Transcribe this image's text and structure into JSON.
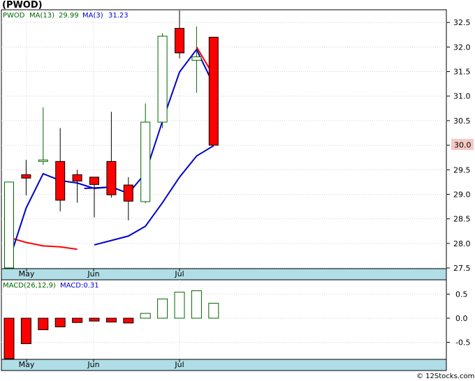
{
  "title": "(PWOD)",
  "footer": "© 12Stocks.com",
  "colors": {
    "up_fill": "#ffffff",
    "up_stroke": "#006400",
    "down_fill": "#ff0000",
    "down_stroke": "#000000",
    "ma13": "#ff0000",
    "ma3": "#0000cc",
    "axis_bar": "#b0dde6",
    "grid": "#d3d3d3",
    "last_label_bg": "#f5c9c4"
  },
  "price_legend": {
    "symbol": "PWOD",
    "ma13_label": "MA(13)",
    "ma13_value": "29.99",
    "ma3_label": "MA(3)",
    "ma3_value": "31.23"
  },
  "macd_legend": {
    "label": "MACD(26,12,9)",
    "value_label": "MACD:0.31"
  },
  "last_price_label": "30.0",
  "x_axis_labels": [
    "May",
    "Jun",
    "Jul"
  ],
  "chart_data": [
    {
      "type": "candlestick",
      "ylim": [
        27.4,
        32.75
      ],
      "yticks": [
        "27.5",
        "28.0",
        "28.5",
        "29.0",
        "29.5",
        "30.0",
        "30.5",
        "31.0",
        "31.5",
        "32.0",
        "32.5"
      ],
      "candles": [
        {
          "o": 27.5,
          "h": 29.25,
          "l": 27.5,
          "c": 29.25
        },
        {
          "o": 29.4,
          "h": 29.7,
          "l": 28.98,
          "c": 29.33
        },
        {
          "o": 29.67,
          "h": 30.77,
          "l": 29.6,
          "c": 29.7
        },
        {
          "o": 29.67,
          "h": 30.35,
          "l": 28.65,
          "c": 28.88
        },
        {
          "o": 29.4,
          "h": 29.5,
          "l": 28.83,
          "c": 29.27
        },
        {
          "o": 29.35,
          "h": 29.35,
          "l": 28.53,
          "c": 29.2
        },
        {
          "o": 29.67,
          "h": 30.68,
          "l": 28.93,
          "c": 28.99
        },
        {
          "o": 29.19,
          "h": 29.35,
          "l": 28.47,
          "c": 28.86
        },
        {
          "o": 28.85,
          "h": 30.85,
          "l": 28.82,
          "c": 30.47
        },
        {
          "o": 30.47,
          "h": 32.28,
          "l": 30.35,
          "c": 32.22
        },
        {
          "o": 32.38,
          "h": 32.75,
          "l": 31.77,
          "c": 31.88
        },
        {
          "o": 31.73,
          "h": 32.42,
          "l": 31.07,
          "c": 31.8
        },
        {
          "o": 32.2,
          "h": 32.2,
          "l": 30.0,
          "c": 30.0
        }
      ],
      "series": [
        {
          "name": "MA(13)",
          "values": [
            28.12,
            28.02,
            27.95,
            27.93,
            27.88,
            null,
            null,
            null,
            null,
            null,
            null,
            32.0,
            31.42
          ]
        },
        {
          "name": "MA(3)",
          "values": [
            27.65,
            28.72,
            29.42,
            29.28,
            29.23,
            29.12,
            29.15,
            29.02,
            29.43,
            30.49,
            31.49,
            31.95,
            31.23
          ]
        },
        {
          "name": "lower",
          "values": [
            null,
            null,
            null,
            null,
            null,
            27.97,
            28.06,
            28.15,
            28.35,
            28.83,
            29.35,
            29.78,
            29.99
          ]
        }
      ]
    },
    {
      "type": "bar",
      "ylim": [
        -0.9,
        0.75
      ],
      "yticks": [
        "0.5",
        "0.0",
        "-0.5"
      ],
      "values": [
        -0.87,
        -0.53,
        -0.24,
        -0.18,
        -0.09,
        -0.06,
        -0.08,
        -0.1,
        0.1,
        0.4,
        0.54,
        0.57,
        0.31
      ]
    }
  ]
}
